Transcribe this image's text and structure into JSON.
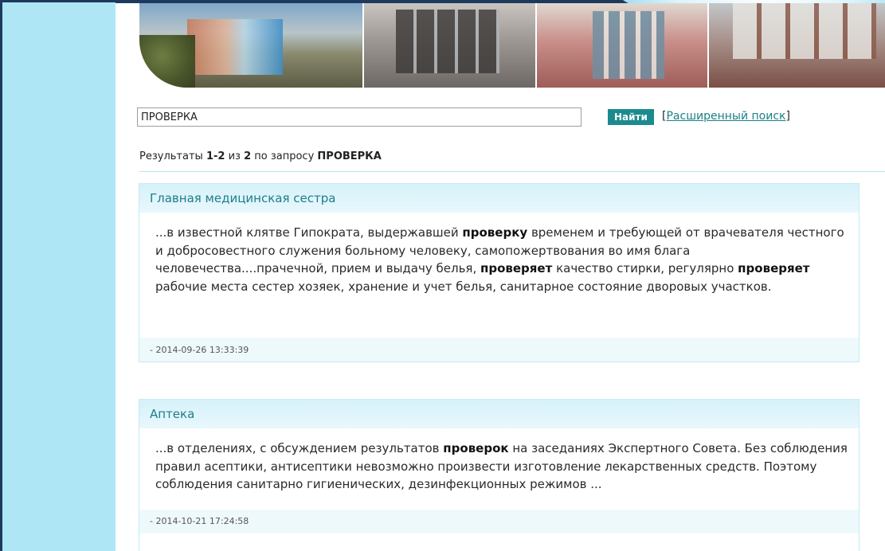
{
  "search": {
    "query": "ПРОВЕРКА",
    "button_label": "Найти",
    "advanced_open_bracket": "[",
    "advanced_label": "Расширенный поиск",
    "advanced_close_bracket": "]"
  },
  "summary": {
    "prefix": "Результаты ",
    "range": "1-2",
    "of_word": " из ",
    "total": "2",
    "query_label": " по запросу ",
    "query": "ПРОВЕРКА"
  },
  "results": [
    {
      "title": "Главная медицинская сестра",
      "snippet": [
        {
          "text": "...в известной клятве Гипократа, выдержавшей ",
          "bold": false
        },
        {
          "text": "проверку",
          "bold": true
        },
        {
          "text": " временем и требующей от врачевателя честного и добросовестного служения больному человеку, самопожертвования во имя блага человечества....прачечной, прием и выдачу белья, ",
          "bold": false
        },
        {
          "text": "проверяет",
          "bold": true
        },
        {
          "text": " качество стирки, регулярно ",
          "bold": false
        },
        {
          "text": "проверяет",
          "bold": true
        },
        {
          "text": " рабочие места сестер хозяек, хранение и учет белья, санитарное состояние дворовых участков.",
          "bold": false
        }
      ],
      "date": "- 2014-09-26 13:33:39"
    },
    {
      "title": "Аптека",
      "snippet": [
        {
          "text": "...в отделениях, с обсуждением результатов ",
          "bold": false
        },
        {
          "text": "проверок",
          "bold": true
        },
        {
          "text": " на заседаниях Экспертного Совета. Без соблюдения правил асептики, антисептики невозможно произвести изготовление лекарственных средств. Поэтому соблюдения санитарно гигиенических, дезинфекционных режимов ...",
          "bold": false
        }
      ],
      "date": "- 2014-10-21 17:24:58"
    }
  ],
  "colors": {
    "frame_left": "#aee6f5",
    "frame_border": "#1d3a5c",
    "accent_button": "#1b8a8e",
    "title_link": "#1f7d8a",
    "card_header": "#d6f1f9"
  }
}
